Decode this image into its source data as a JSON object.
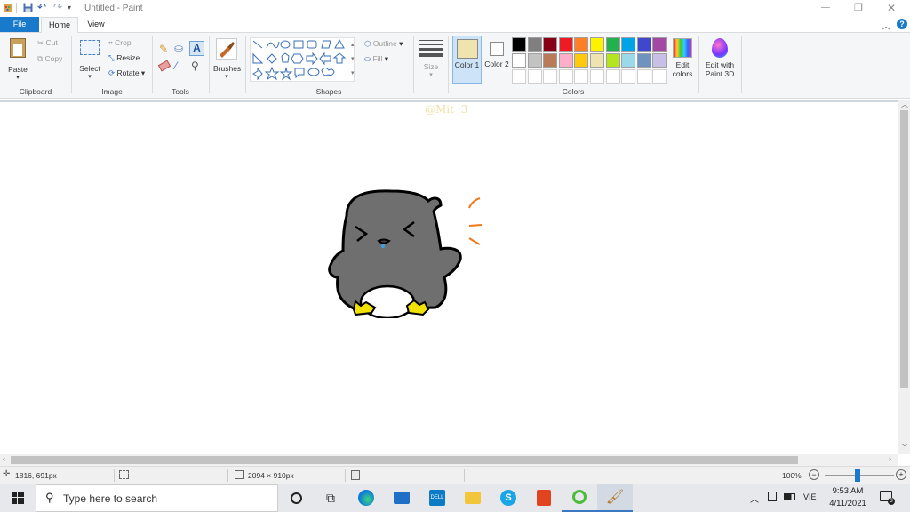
{
  "window": {
    "title": "Untitled - Paint",
    "buttons": {
      "minimize": "—",
      "maximize": "❐",
      "close": "✕"
    }
  },
  "tabs": {
    "file": "File",
    "home": "Home",
    "view": "View"
  },
  "ribbon": {
    "clipboard": {
      "paste": "Paste",
      "cut": "Cut",
      "copy": "Copy",
      "group": "Clipboard"
    },
    "image": {
      "select": "Select",
      "crop": "Crop",
      "resize": "Resize",
      "rotate": "Rotate",
      "group": "Image"
    },
    "tools": {
      "group": "Tools"
    },
    "brushes": {
      "label": "Brushes"
    },
    "shapes": {
      "outline": "Outline",
      "fill": "Fill",
      "group": "Shapes"
    },
    "size": {
      "label": "Size"
    },
    "colors": {
      "color1": "Color 1",
      "color1_value": "#efe3b0",
      "color2": "Color 2",
      "color2_value": "#ffffff",
      "edit": "Edit colors",
      "group": "Colors",
      "palette_row1": [
        "#000000",
        "#7f7f7f",
        "#880015",
        "#ed1c24",
        "#ff7f27",
        "#fff200",
        "#22b14c",
        "#00a2e8",
        "#3f48cc",
        "#a349a4"
      ],
      "palette_row2": [
        "#ffffff",
        "#c3c3c3",
        "#b97a57",
        "#ffaec9",
        "#ffc90e",
        "#efe4b0",
        "#b5e61d",
        "#99d9ea",
        "#7092be",
        "#c8bfe7"
      ]
    },
    "paint3d": "Edit with Paint 3D"
  },
  "canvas": {
    "watermark": "@Mit :3",
    "drawing_colors": {
      "body": "#6f6f6f",
      "feet": "#f2e200",
      "accent": "#f07a1a"
    }
  },
  "status": {
    "cursor": "1816, 691px",
    "selection": "",
    "image_size": "2094 × 910px",
    "zoom": "100%"
  },
  "taskbar": {
    "search_placeholder": "Type here to search",
    "lang": "VIE",
    "time": "9:53 AM",
    "date": "4/11/2021"
  }
}
